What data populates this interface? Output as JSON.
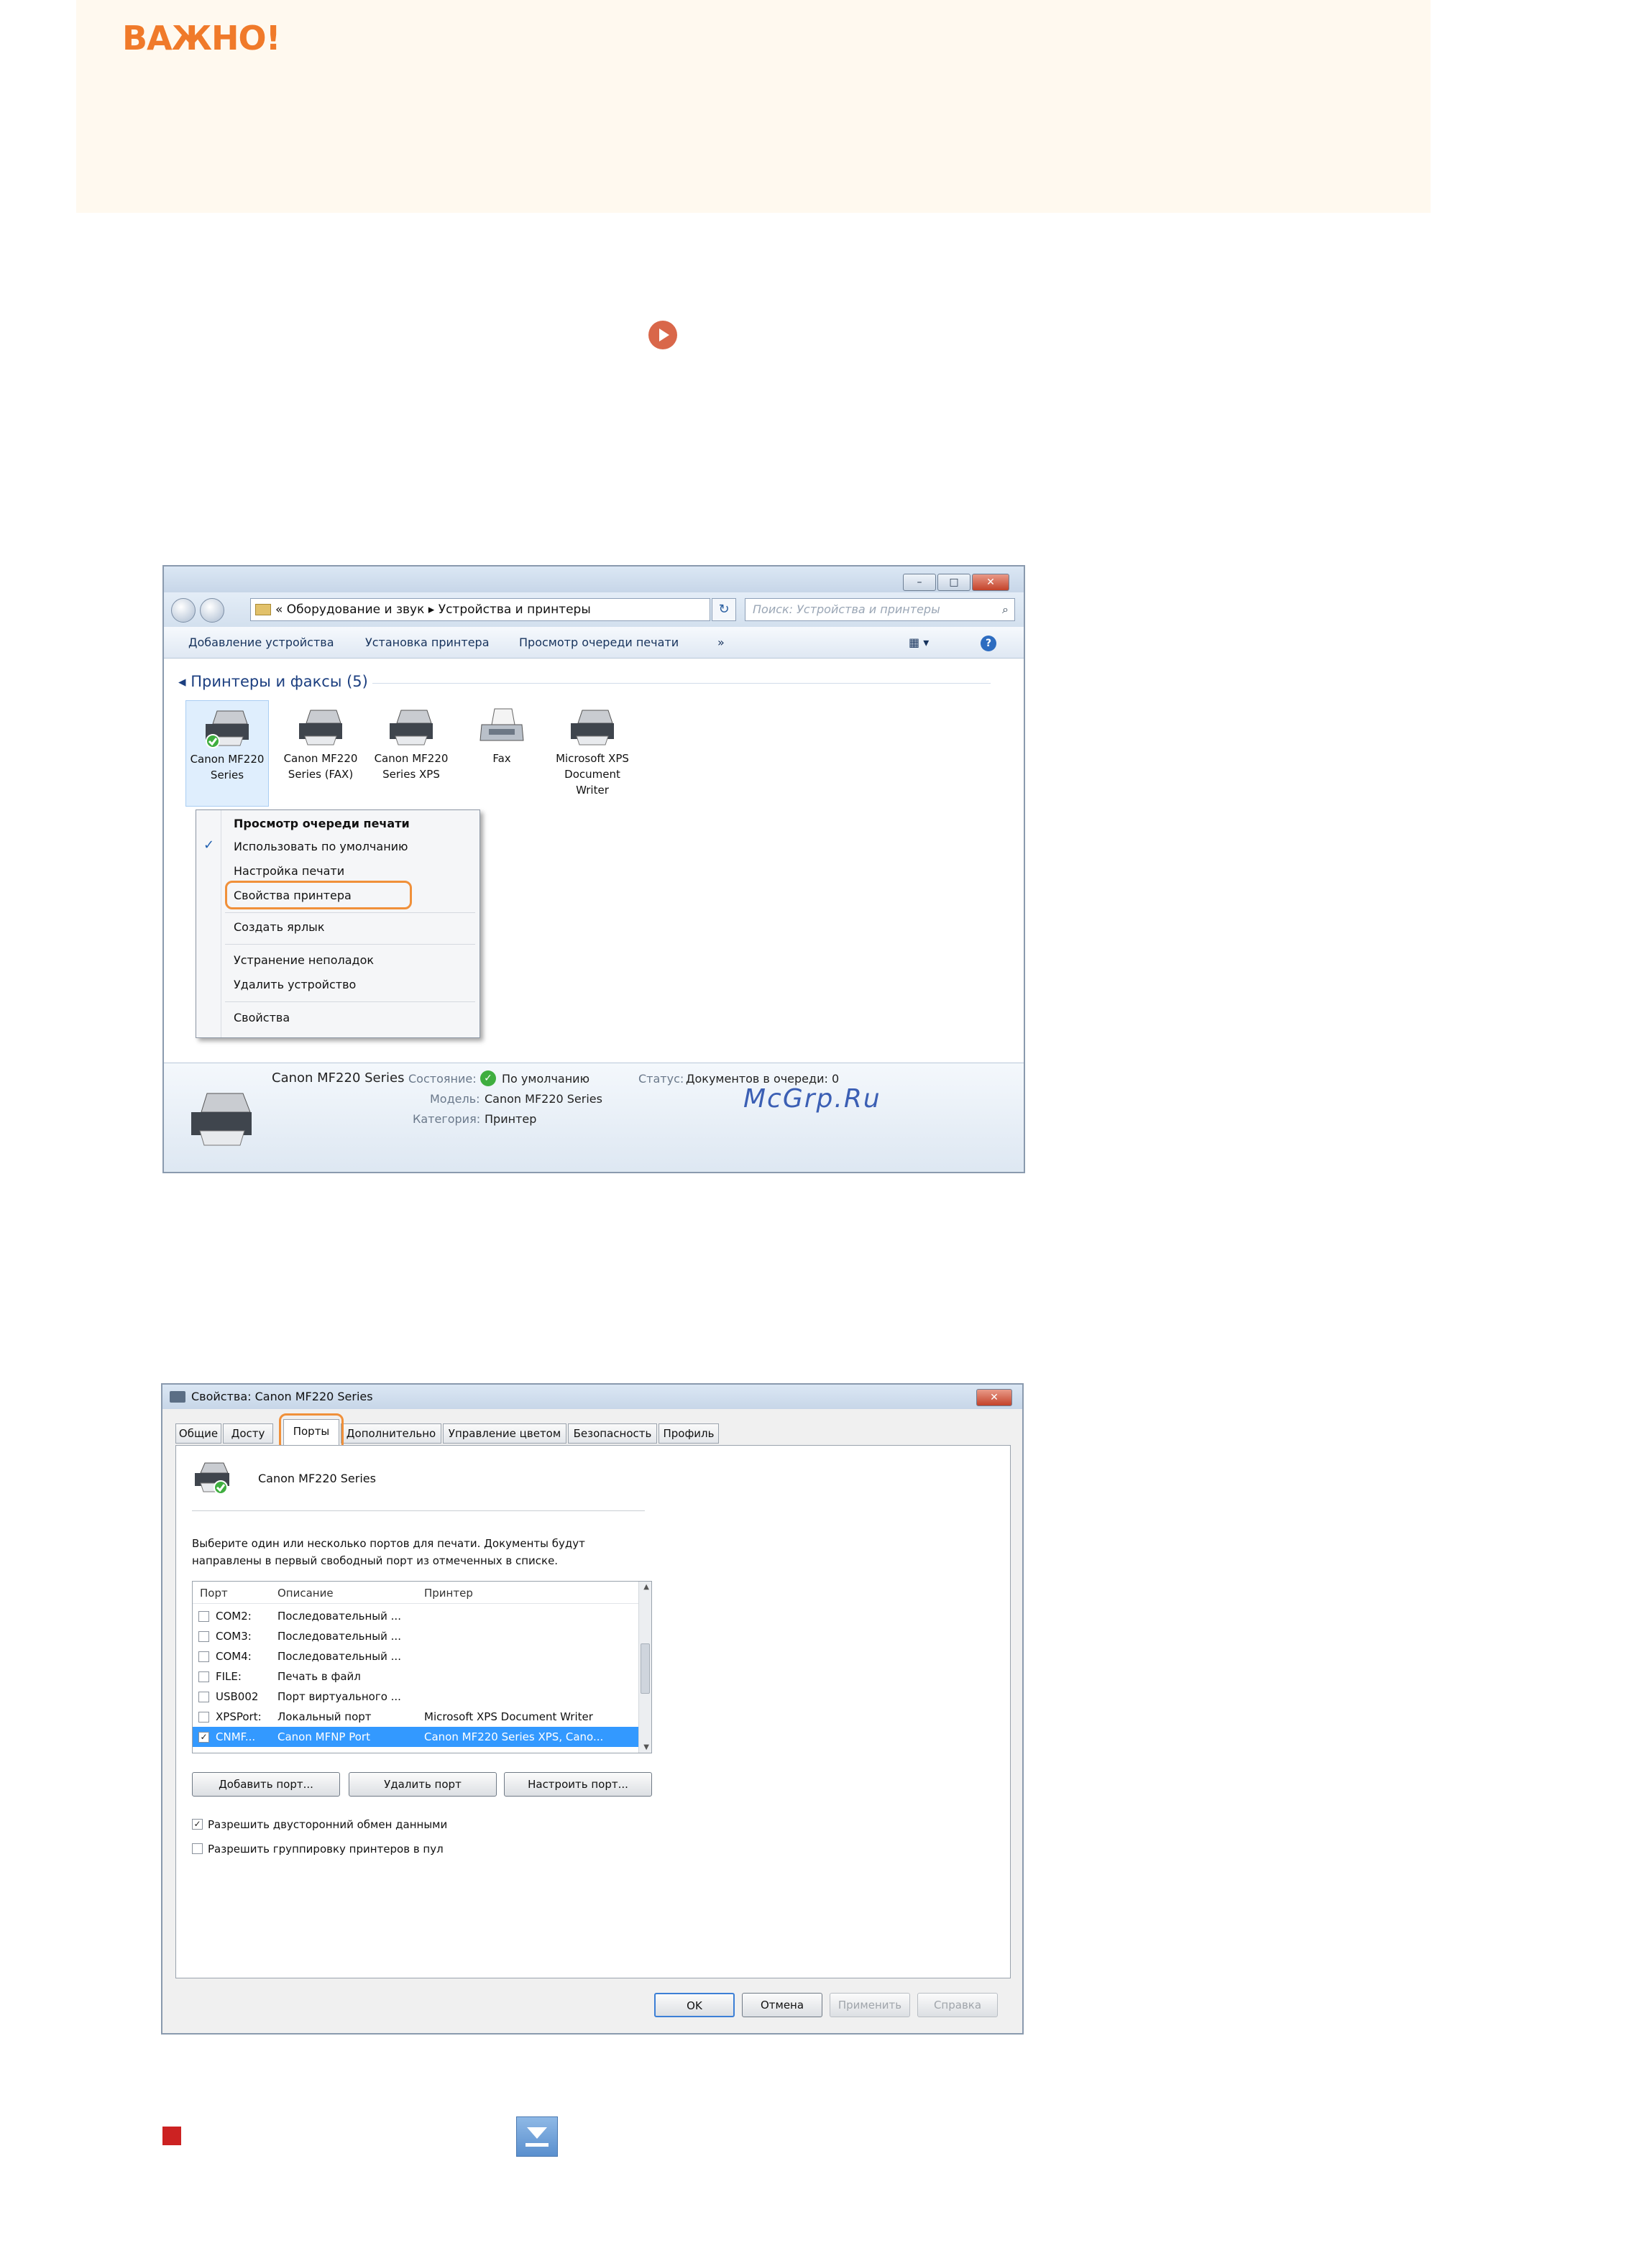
{
  "important": {
    "title": "ВАЖНО!"
  },
  "explorer": {
    "title_buttons": {
      "minimize": "–",
      "maximize": "□",
      "close": "✕"
    },
    "address": "« Оборудование и звук ▸ Устройства и принтеры",
    "search_placeholder": "Поиск: Устройства и принтеры",
    "refresh_glyph": "↻",
    "search_glyph": "⌕",
    "commands": [
      "Добавление устройства",
      "Установка принтера",
      "Просмотр очереди печати",
      "»"
    ],
    "view_glyph": "▦ ▾",
    "help_glyph": "?",
    "group_title": "◂ Принтеры и факсы (5)",
    "devices": [
      {
        "label": "Canon MF220 Series"
      },
      {
        "label": "Canon MF220 Series (FAX)"
      },
      {
        "label": "Canon MF220 Series XPS"
      },
      {
        "label": "Fax"
      },
      {
        "label": "Microsoft XPS Document Writer"
      }
    ],
    "context_menu": {
      "check_glyph": "✓",
      "items": [
        "Просмотр очереди печати",
        "Использовать по умолчанию",
        "Настройка печати",
        "Свойства принтера",
        "Создать ярлык",
        "Устранение неполадок",
        "Удалить устройство",
        "Свойства"
      ]
    },
    "status": {
      "name": "Canon MF220 Series",
      "state_label": "Состояние:",
      "state_value": "По умолчанию",
      "model_label": "Модель:",
      "model_value": "Canon MF220 Series",
      "category_label": "Категория:",
      "category_value": "Принтер",
      "queue_label": "Статус:",
      "queue_value": "Документов в очереди: 0"
    }
  },
  "watermark": "McGrp.Ru",
  "dialog": {
    "title": "Свойства: Canon MF220 Series",
    "close_glyph": "✕",
    "tabs": [
      "Общие",
      "Досту",
      "Порты",
      "Дополнительно",
      "Управление цветом",
      "Безопасность",
      "Профиль"
    ],
    "active_tab": "Порты",
    "printer_name": "Canon MF220 Series",
    "instruction": "Выберите один или несколько портов для печати. Документы будут направлены в первый свободный порт из отмеченных в списке.",
    "columns": [
      "Порт",
      "Описание",
      "Принтер"
    ],
    "ports": [
      {
        "port": "COM2:",
        "desc": "Последовательный ...",
        "printer": "",
        "checked": false,
        "selected": false
      },
      {
        "port": "COM3:",
        "desc": "Последовательный ...",
        "printer": "",
        "checked": false,
        "selected": false
      },
      {
        "port": "COM4:",
        "desc": "Последовательный ...",
        "printer": "",
        "checked": false,
        "selected": false
      },
      {
        "port": "FILE:",
        "desc": "Печать в файл",
        "printer": "",
        "checked": false,
        "selected": false
      },
      {
        "port": "USB002",
        "desc": "Порт виртуального ...",
        "printer": "",
        "checked": false,
        "selected": false
      },
      {
        "port": "XPSPort:",
        "desc": "Локальный порт",
        "printer": "Microsoft XPS Document Writer",
        "checked": false,
        "selected": false
      },
      {
        "port": "CNMF...",
        "desc": "Canon MFNP Port",
        "printer": "Canon MF220 Series XPS, Cano...",
        "checked": true,
        "selected": true
      }
    ],
    "buttons": {
      "add_port": "Добавить порт...",
      "delete_port": "Удалить порт",
      "configure_port": "Настроить порт..."
    },
    "options": [
      {
        "label": "Разрешить двусторонний обмен данными",
        "checked": true
      },
      {
        "label": "Разрешить группировку принтеров в пул",
        "checked": false
      }
    ],
    "footer": {
      "ok": "OK",
      "cancel": "Отмена",
      "apply": "Применить",
      "help": "Справка"
    }
  }
}
